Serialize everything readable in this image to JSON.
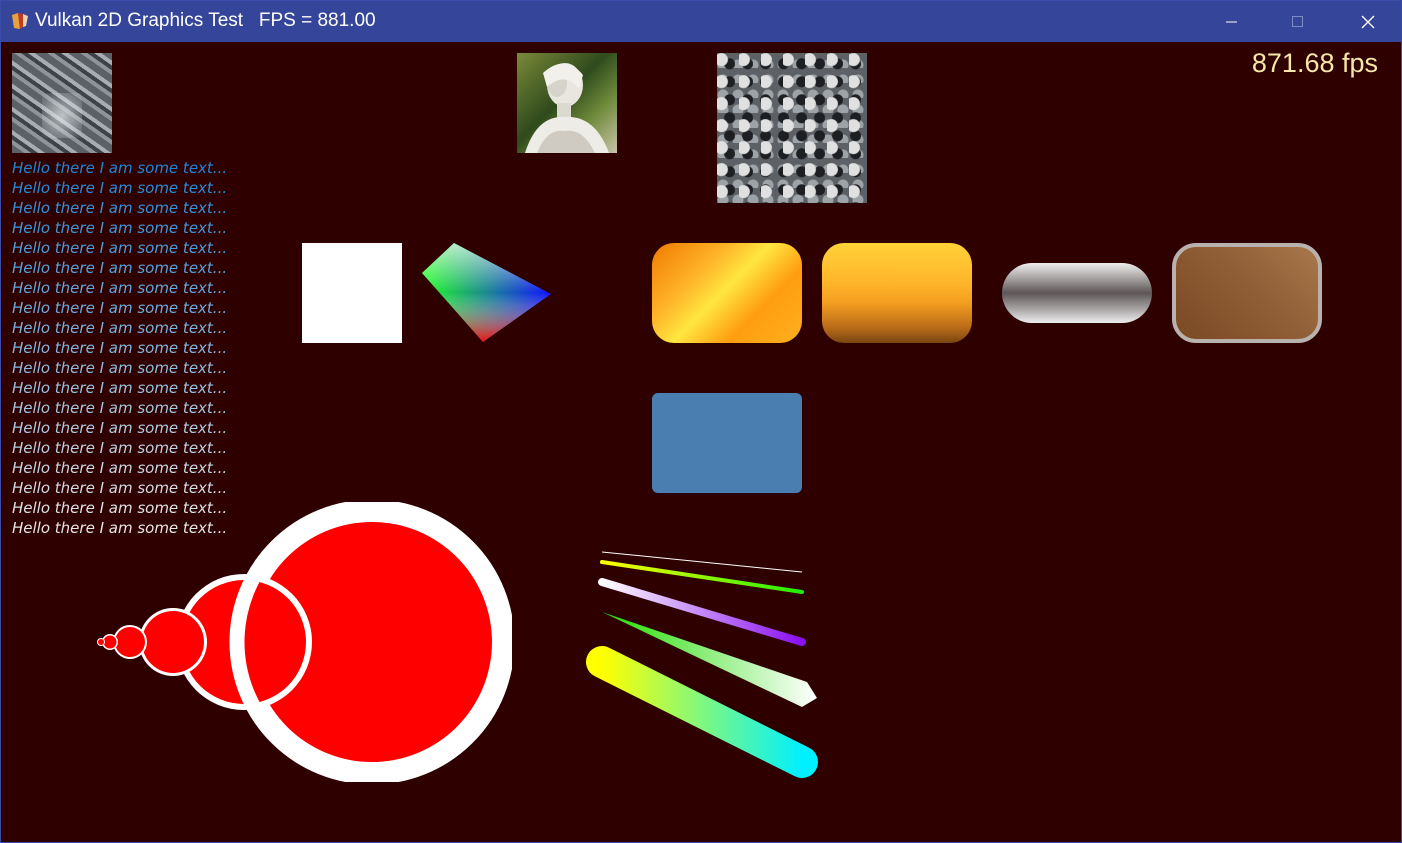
{
  "window": {
    "title": "Vulkan 2D Graphics Test   FPS = 881.00",
    "controls": [
      "minimize",
      "maximize",
      "close"
    ],
    "titlebar_color": "#35459a"
  },
  "canvas": {
    "background": "#2f0000",
    "fps_overlay": "871.68 fps",
    "text_lines": [
      "Hello there I am some text...",
      "Hello there I am some text...",
      "Hello there I am some text...",
      "Hello there I am some text...",
      "Hello there I am some text...",
      "Hello there I am some text...",
      "Hello there I am some text...",
      "Hello there I am some text...",
      "Hello there I am some text...",
      "Hello there I am some text...",
      "Hello there I am some text...",
      "Hello there I am some text...",
      "Hello there I am some text...",
      "Hello there I am some text...",
      "Hello there I am some text...",
      "Hello there I am some text...",
      "Hello there I am some text...",
      "Hello there I am some text...",
      "Hello there I am some text..."
    ],
    "text_gradient": [
      "#1e86d8",
      "#e6e6e6"
    ],
    "textures": [
      "rock-texture",
      "statue-photo",
      "gravel-texture"
    ],
    "shapes": [
      "white-square",
      "rgb-gradient-quad",
      "orange-diagonal-gradient-rounded-rect",
      "orange-vertical-gradient-rounded-rect",
      "grey-metallic-pill",
      "brown-bordered-rounded-rect",
      "steel-blue-rounded-rect"
    ],
    "shape_colors": {
      "steel_blue": "#4a7db0",
      "red": "#ff0000",
      "white": "#ffffff"
    }
  }
}
